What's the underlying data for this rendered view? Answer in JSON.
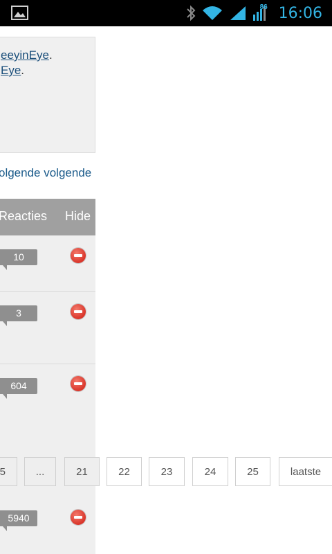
{
  "status_bar": {
    "notification_icon": "image-icon",
    "bluetooth_icon": "bluetooth-icon",
    "wifi_icon": "wifi-icon",
    "signal_icon": "signal-icon",
    "data_label": "86",
    "time": "16:06"
  },
  "info_box": {
    "line1_link": "eeyinEye",
    "line1_suffix": ".",
    "line2_link": "Eye",
    "line2_suffix": "."
  },
  "pager_text": "olgende volgende",
  "table": {
    "col_reacties": "Reacties",
    "col_hide": "Hide",
    "rows": [
      {
        "count": "10"
      },
      {
        "count": "3"
      },
      {
        "count": "604"
      },
      {
        "count": "5940"
      }
    ]
  },
  "pagination": {
    "items": [
      "5",
      "...",
      "21",
      "22",
      "23",
      "24",
      "25",
      "laatste"
    ]
  }
}
